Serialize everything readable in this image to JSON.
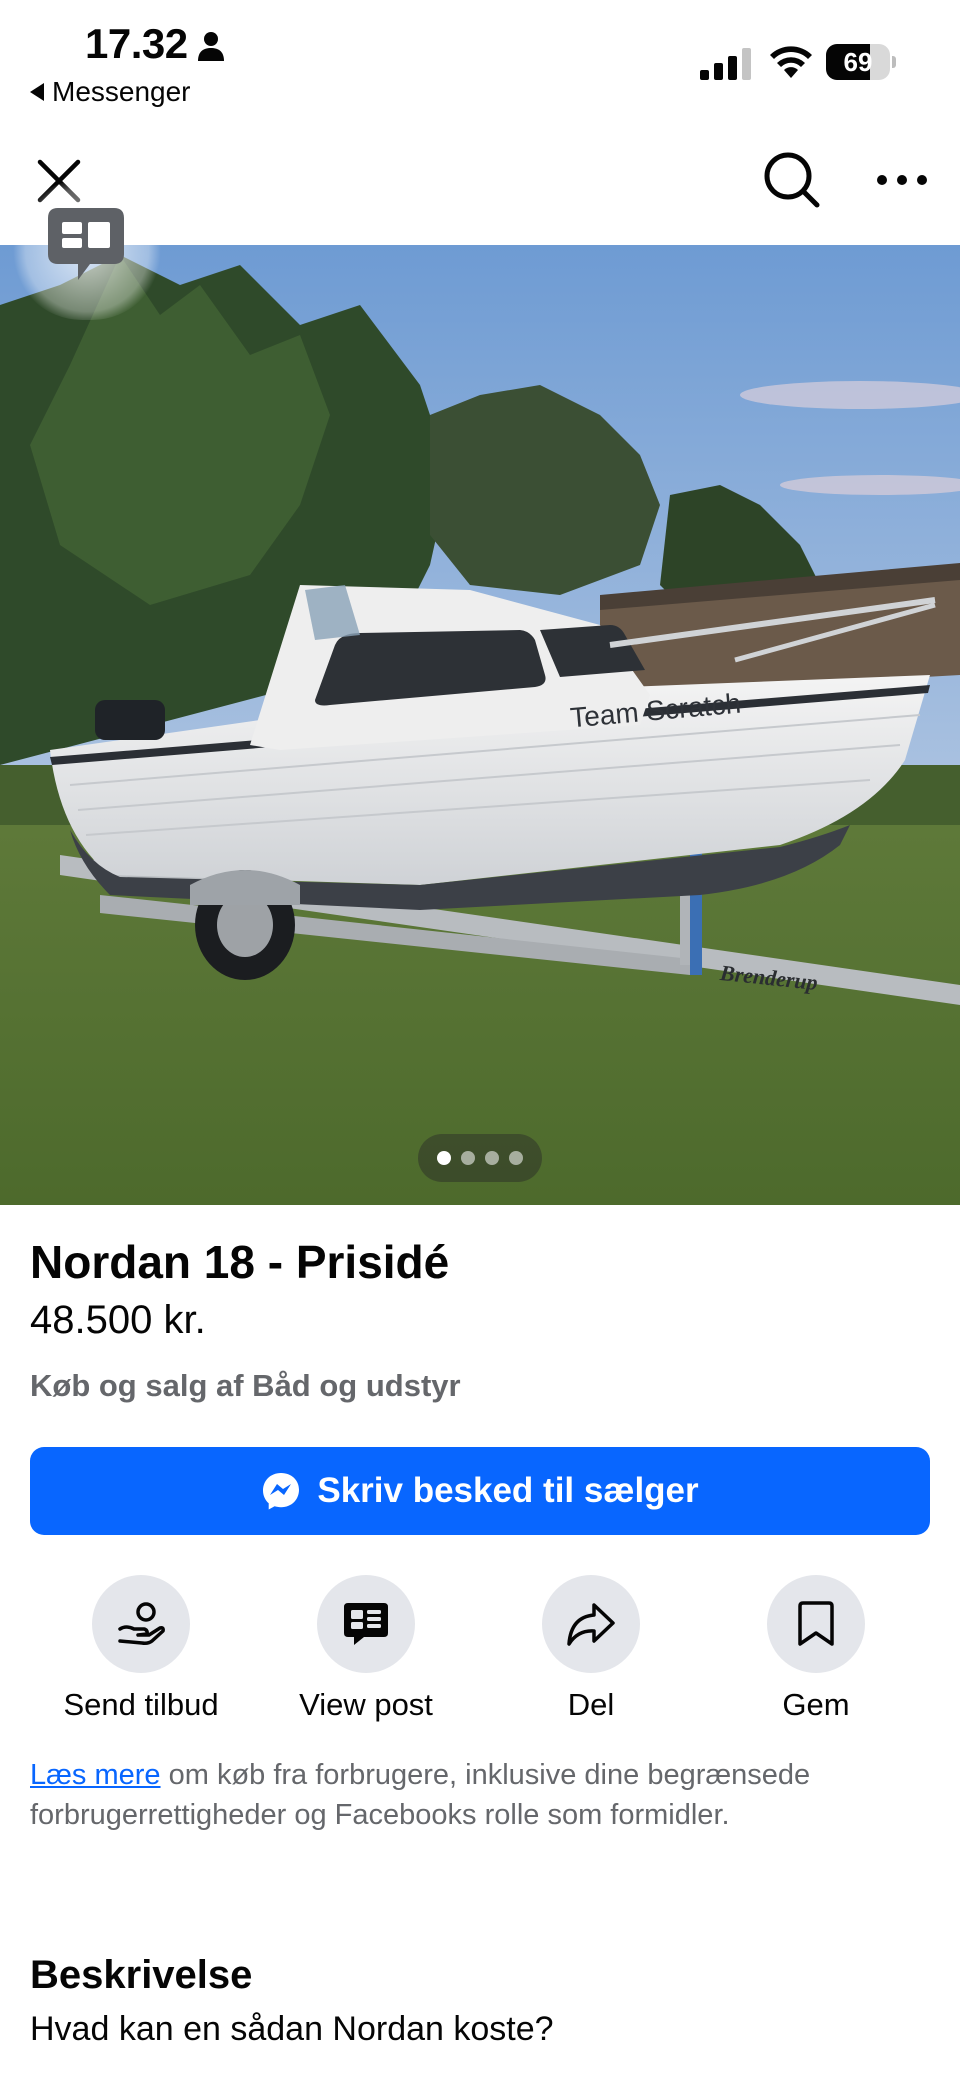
{
  "status_bar": {
    "time": "17.32",
    "back_app": "Messenger",
    "battery": "69",
    "battery_level": 0.69
  },
  "listing": {
    "title": "Nordan 18 - Prisidé",
    "price": "48.500 kr.",
    "category": "Køb og salg af Båd og udstyr",
    "boat_name_on_hull": "Team Scratch",
    "trailer_brand": "Brenderup",
    "photo_count": 4,
    "photo_index": 1
  },
  "cta": {
    "label": "Skriv besked til sælger"
  },
  "actions": [
    {
      "label": "Send tilbud",
      "icon": "offer-hand-icon"
    },
    {
      "label": "View post",
      "icon": "post-icon"
    },
    {
      "label": "Del",
      "icon": "share-icon"
    },
    {
      "label": "Gem",
      "icon": "bookmark-icon"
    }
  ],
  "legal": {
    "link": "Læs mere",
    "text": " om køb fra forbrugere, inklusive dine begrænsede forbrugerrettigheder og Facebooks rolle som formidler."
  },
  "description": {
    "heading": "Beskrivelse",
    "body": "Hvad kan en sådan Nordan koste?"
  },
  "colors": {
    "accent": "#0866ff",
    "secondary_text": "#65676b",
    "button_bg": "#e4e6eb"
  }
}
